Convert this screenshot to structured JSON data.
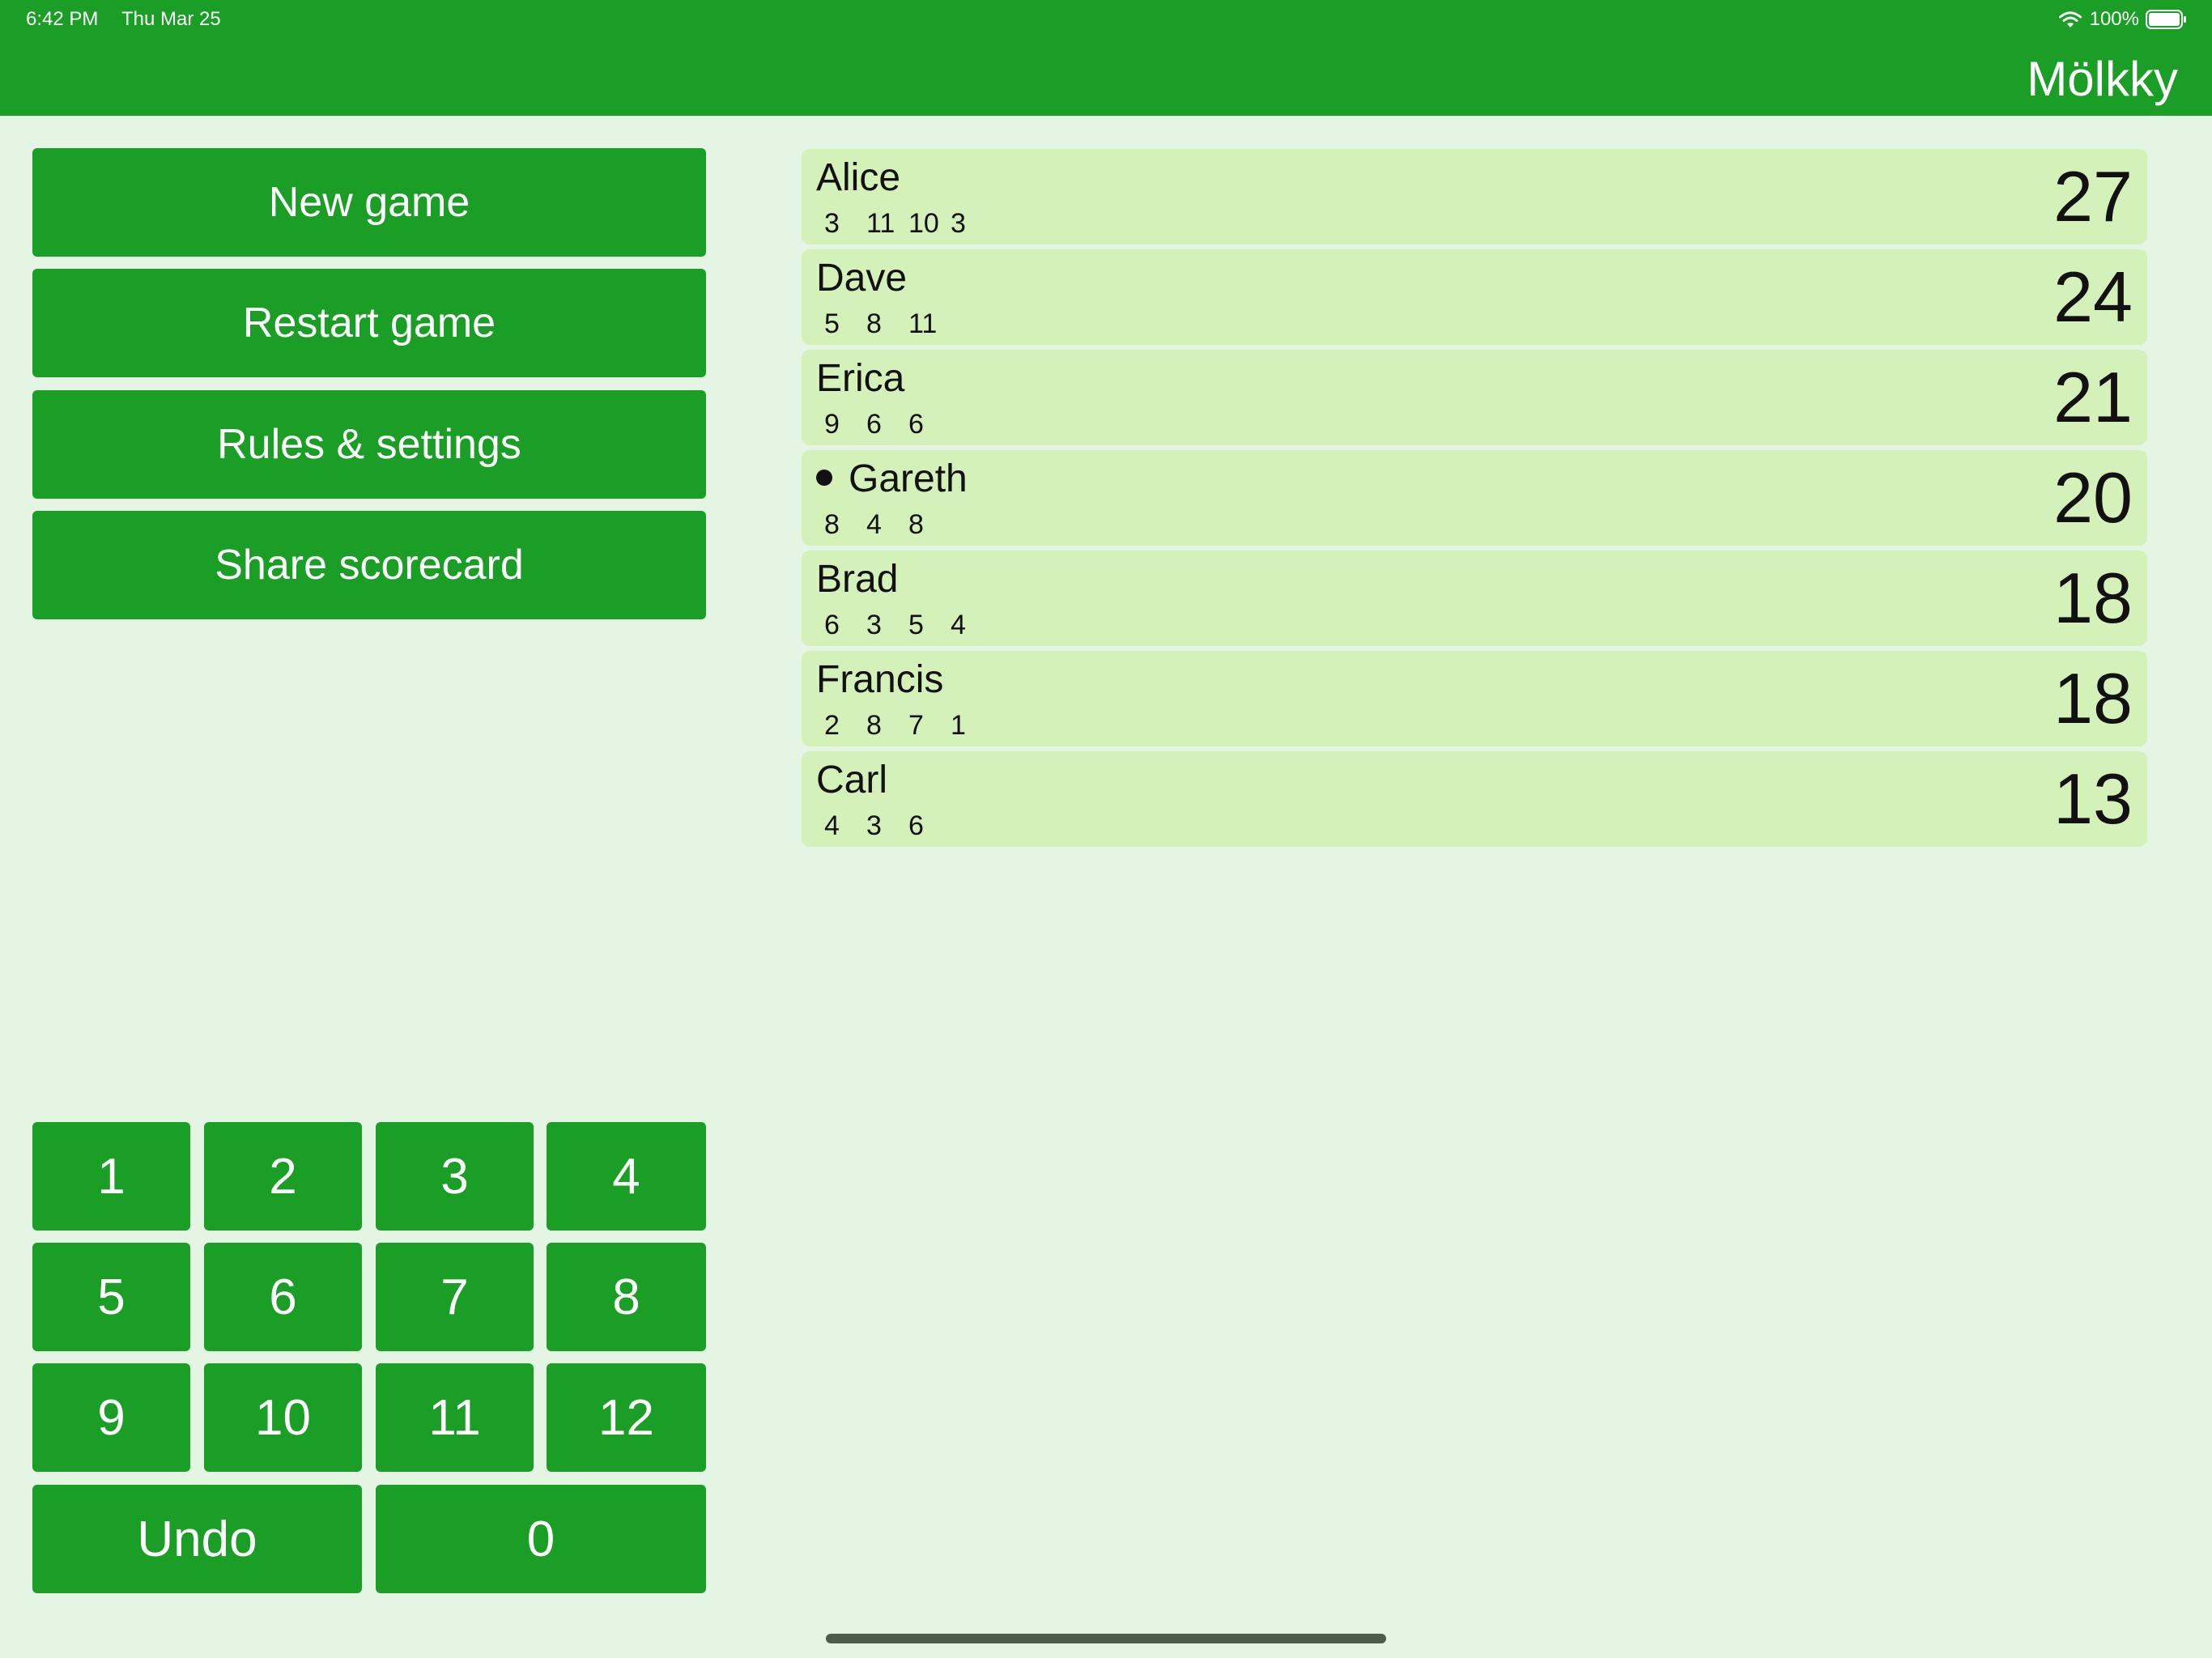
{
  "status_bar": {
    "time": "6:42 PM",
    "date": "Thu Mar 25",
    "battery": "100%"
  },
  "app": {
    "title": "Mölkky"
  },
  "menu": {
    "new_game": "New game",
    "restart_game": "Restart game",
    "rules_settings": "Rules & settings",
    "share_scorecard": "Share scorecard"
  },
  "keypad": {
    "keys": [
      "1",
      "2",
      "3",
      "4",
      "5",
      "6",
      "7",
      "8",
      "9",
      "10",
      "11",
      "12"
    ],
    "undo": "Undo",
    "zero": "0"
  },
  "players": [
    {
      "name": "Alice",
      "throws": [
        "3",
        "11",
        "10",
        "3"
      ],
      "score": "27",
      "current": false
    },
    {
      "name": "Dave",
      "throws": [
        "5",
        "8",
        "11"
      ],
      "score": "24",
      "current": false
    },
    {
      "name": "Erica",
      "throws": [
        "9",
        "6",
        "6"
      ],
      "score": "21",
      "current": false
    },
    {
      "name": "Gareth",
      "throws": [
        "8",
        "4",
        "8"
      ],
      "score": "20",
      "current": true
    },
    {
      "name": "Brad",
      "throws": [
        "6",
        "3",
        "5",
        "4"
      ],
      "score": "18",
      "current": false
    },
    {
      "name": "Francis",
      "throws": [
        "2",
        "8",
        "7",
        "1"
      ],
      "score": "18",
      "current": false
    },
    {
      "name": "Carl",
      "throws": [
        "4",
        "3",
        "6"
      ],
      "score": "13",
      "current": false
    }
  ],
  "icons": {
    "wifi": "wifi-icon",
    "battery": "battery-icon",
    "current_turn": "current-turn-dot"
  },
  "colors": {
    "brand_green": "#1a9e26",
    "background": "#e4f6e3",
    "row_background": "#d4f1b9"
  }
}
